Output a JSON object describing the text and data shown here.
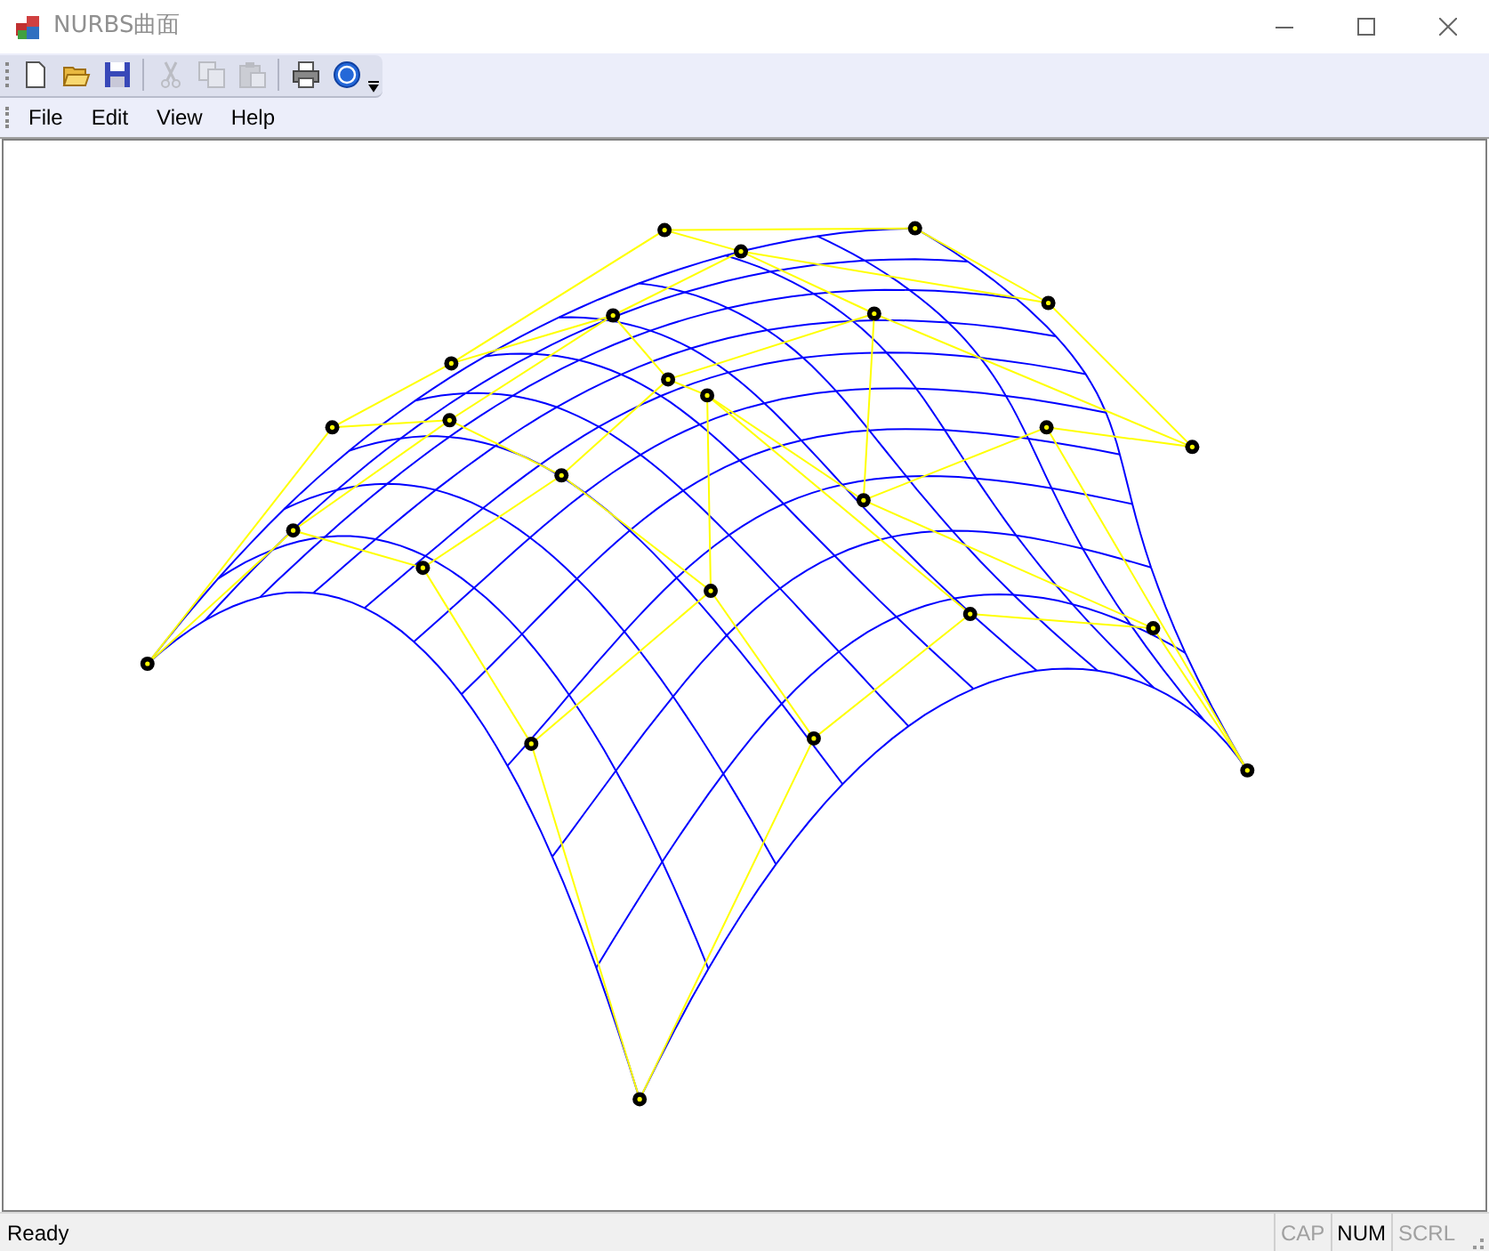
{
  "window": {
    "title": "NURBS曲面"
  },
  "toolbar": [
    {
      "kind": "new",
      "disabled": false
    },
    {
      "kind": "open",
      "disabled": false
    },
    {
      "kind": "save",
      "disabled": false
    },
    {
      "kind": "separator"
    },
    {
      "kind": "cut",
      "disabled": true
    },
    {
      "kind": "copy",
      "disabled": true
    },
    {
      "kind": "paste",
      "disabled": true
    },
    {
      "kind": "separator"
    },
    {
      "kind": "print",
      "disabled": false
    },
    {
      "kind": "help",
      "disabled": false
    }
  ],
  "menu": [
    "File",
    "Edit",
    "View",
    "Help"
  ],
  "status_bar": {
    "message": "Ready",
    "indicators": [
      {
        "label": "CAP",
        "on": false
      },
      {
        "label": "NUM",
        "on": true
      },
      {
        "label": "SCRL",
        "on": false
      }
    ]
  }
}
